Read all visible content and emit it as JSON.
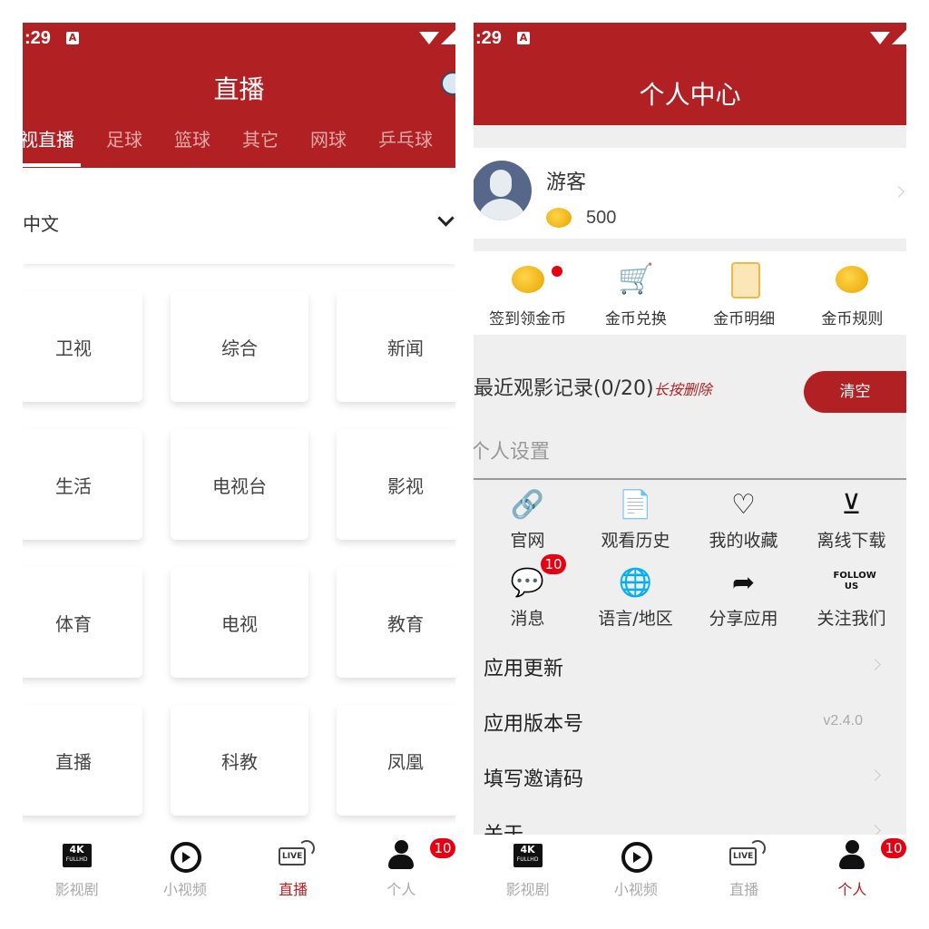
{
  "status_bar": {
    "time": ":29",
    "notification_icon": "A"
  },
  "left_screen": {
    "title": "直播",
    "search_icon": "search-icon",
    "tabs": [
      {
        "label": "视直播",
        "active": true
      },
      {
        "label": "足球"
      },
      {
        "label": "篮球"
      },
      {
        "label": "其它"
      },
      {
        "label": "网球"
      },
      {
        "label": "乒乓球"
      }
    ],
    "language_select": {
      "value": "中文"
    },
    "categories": [
      "卫视",
      "综合",
      "新闻",
      "生活",
      "电视台",
      "影视",
      "体育",
      "电视",
      "教育",
      "直播",
      "科教",
      "凤凰"
    ]
  },
  "right_screen": {
    "title": "个人中心",
    "profile": {
      "name": "游客",
      "coins": "500"
    },
    "coin_actions": [
      {
        "label": "签到领金币",
        "icon": "coins-icon",
        "dot": true
      },
      {
        "label": "金币兑换",
        "icon": "shopping-cart-icon"
      },
      {
        "label": "金币明细",
        "icon": "clipboard-icon"
      },
      {
        "label": "金币规则",
        "icon": "coins-icon"
      }
    ],
    "recent": {
      "title": "最近观影记录(0/20)",
      "hint": "长按删除",
      "clear_label": "清空"
    },
    "settings_title": "个人设置",
    "settings_grid": [
      {
        "label": "官网",
        "icon": "link-icon"
      },
      {
        "label": "观看历史",
        "icon": "history-icon"
      },
      {
        "label": "我的收藏",
        "icon": "heart-icon"
      },
      {
        "label": "离线下载",
        "icon": "download-icon"
      },
      {
        "label": "消息",
        "icon": "message-icon",
        "badge": "10"
      },
      {
        "label": "语言/地区",
        "icon": "globe-icon"
      },
      {
        "label": "分享应用",
        "icon": "share-icon"
      },
      {
        "label": "关注我们",
        "icon": "follow-us-icon",
        "icon_text": "FOLLOW US"
      }
    ],
    "rows": [
      {
        "label": "应用更新"
      },
      {
        "label": "应用版本号",
        "value": "v2.4.0"
      },
      {
        "label": "填写邀请码"
      },
      {
        "label": "关于"
      }
    ]
  },
  "bottom_nav": {
    "items": [
      {
        "label": "影视剧",
        "icon": "4k-fullhd-icon",
        "icon_text": "4K",
        "icon_sub": "FULLHD"
      },
      {
        "label": "小视频",
        "icon": "play-icon"
      },
      {
        "label": "直播",
        "icon": "live-icon",
        "icon_text": "LIVE"
      },
      {
        "label": "个人",
        "icon": "user-icon",
        "badge": "10"
      }
    ],
    "left_active": 2,
    "right_active": 3
  },
  "colors": {
    "accent": "#b12123",
    "badge": "#e60012"
  }
}
